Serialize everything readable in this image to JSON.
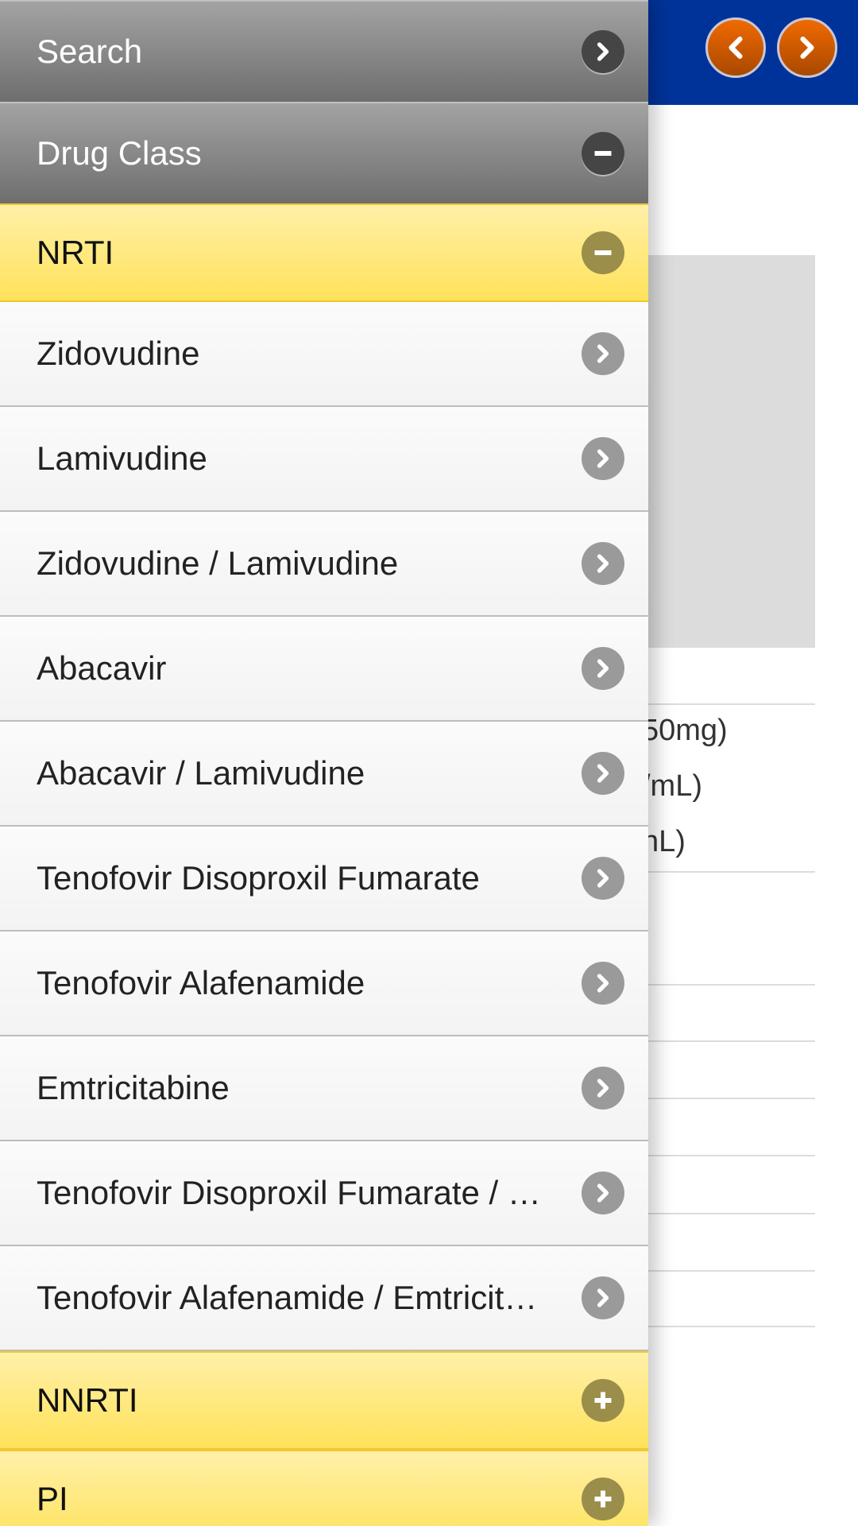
{
  "header": {
    "prev_icon": "chevron-left-icon",
    "next_icon": "chevron-right-icon",
    "accent": "#00339a",
    "button_color": "#e06000"
  },
  "background_text": [
    "50mg)",
    "/mL)",
    "nL)"
  ],
  "menu": {
    "search": {
      "label": "Search",
      "icon": "chevron-right-icon"
    },
    "drug_class": {
      "label": "Drug Class",
      "icon": "minus-icon"
    },
    "nrti": {
      "label": "NRTI",
      "icon": "minus-icon"
    },
    "items": [
      {
        "label": "Zidovudine"
      },
      {
        "label": "Lamivudine"
      },
      {
        "label": "Zidovudine / Lamivudine"
      },
      {
        "label": "Abacavir"
      },
      {
        "label": "Abacavir / Lamivudine"
      },
      {
        "label": "Tenofovir Disoproxil Fumarate"
      },
      {
        "label": "Tenofovir Alafenamide"
      },
      {
        "label": "Emtricitabine"
      },
      {
        "label": "Tenofovir Disoproxil Fumarate / Emtricitabine"
      },
      {
        "label": "Tenofovir Alafenamide / Emtricitabine"
      }
    ],
    "nnrti": {
      "label": "NNRTI",
      "icon": "plus-icon"
    },
    "pi": {
      "label": "PI",
      "icon": "plus-icon"
    }
  }
}
